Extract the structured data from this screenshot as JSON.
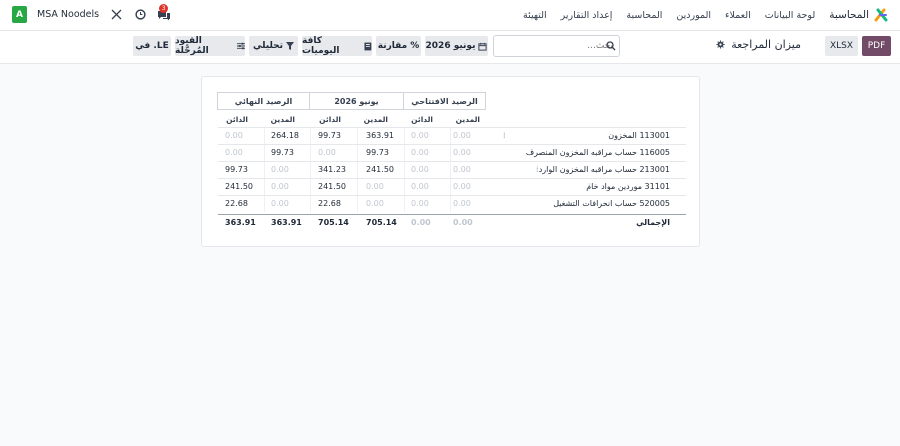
{
  "navbar": {
    "app_name": "المحاسبة",
    "menu": [
      "لوحة البيانات",
      "العملاء",
      "الموردين",
      "المحاسبة",
      "إعداد التقارير",
      "التهيئة"
    ],
    "company": "MSA Noodels",
    "avatar_letter": "A",
    "notification_count": "3"
  },
  "control_panel": {
    "title": "ميزان المراجعة",
    "pdf_label": "PDF",
    "xlsx_label": "XLSX",
    "search_placeholder": "بحث...",
    "date_filter": "يونيو 2026",
    "comparison": "مقارنة",
    "journals": "كافة اليوميات",
    "analytic": "تحليلي",
    "posted_entries": "القيود المُرحَّلة",
    "currency": "في .LE"
  },
  "report": {
    "headers": {
      "opening": "الرصيد الافتتاحي",
      "period": "يونيو 2026",
      "closing": "الرصيد النهائي"
    },
    "subheaders": {
      "debit": "المدين",
      "credit": "الدائن"
    },
    "rows": [
      {
        "account": "113001 المخزون",
        "opening_debit": "0.00",
        "opening_credit": "0.00",
        "period_debit": "363.91",
        "period_credit": "99.73",
        "closing_debit": "264.18",
        "closing_credit": "0.00"
      },
      {
        "account": "116005 حساب مراقبه المخزون المنصرف",
        "opening_debit": "0.00",
        "opening_credit": "0.00",
        "period_debit": "99.73",
        "period_credit": "0.00",
        "closing_debit": "99.73",
        "closing_credit": "0.00"
      },
      {
        "account": "213001 حساب مراقبه المخزون الوارد",
        "opening_debit": "0.00",
        "opening_credit": "0.00",
        "period_debit": "241.50",
        "period_credit": "341.23",
        "closing_debit": "0.00",
        "closing_credit": "99.73"
      },
      {
        "account": "31101 موردين مواد خام",
        "opening_debit": "0.00",
        "opening_credit": "0.00",
        "period_debit": "0.00",
        "period_credit": "241.50",
        "closing_debit": "0.00",
        "closing_credit": "241.50"
      },
      {
        "account": "520005 حساب انحرافات التشغيل",
        "opening_debit": "0.00",
        "opening_credit": "0.00",
        "period_debit": "0.00",
        "period_credit": "22.68",
        "closing_debit": "0.00",
        "closing_credit": "22.68"
      }
    ],
    "total": {
      "account": "الإجمالي",
      "opening_debit": "0.00",
      "opening_credit": "0.00",
      "period_debit": "705.14",
      "period_credit": "705.14",
      "closing_debit": "363.91",
      "closing_credit": "363.91"
    }
  },
  "colors": {
    "brand": "#714b67",
    "avatar": "#28a745",
    "badge": "#e0342b"
  }
}
